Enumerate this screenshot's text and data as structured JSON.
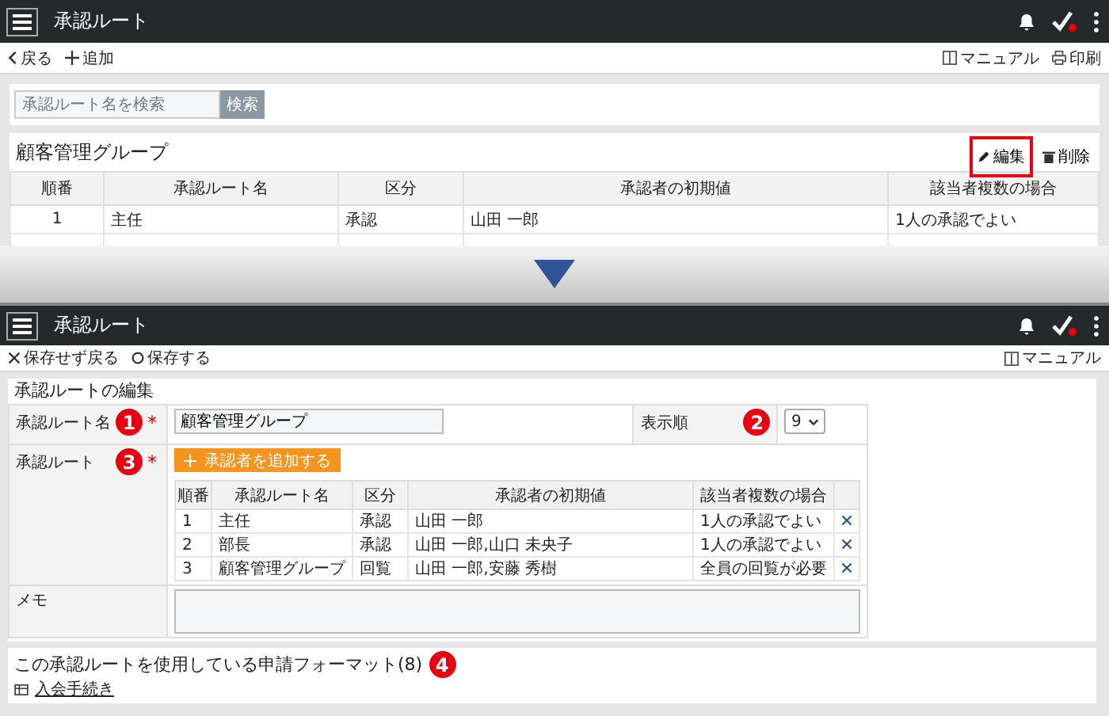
{
  "top_screen": {
    "header": {
      "title": "承認ルート"
    },
    "toolbar": {
      "back": "戻る",
      "add": "追加",
      "manual": "マニュアル",
      "print": "印刷"
    },
    "search": {
      "placeholder": "承認ルート名を検索",
      "button": "検索"
    },
    "group": {
      "title": "顧客管理グループ",
      "edit": "編集",
      "edit_highlighted": true,
      "delete": "削除"
    },
    "table": {
      "columns": [
        "順番",
        "承認ルート名",
        "区分",
        "承認者の初期値",
        "該当者複数の場合"
      ],
      "rows": [
        [
          "1",
          "主任",
          "承認",
          "山田 一郎",
          "1人の承認でよい"
        ]
      ]
    }
  },
  "bottom_screen": {
    "header": {
      "title": "承認ルート"
    },
    "toolbar": {
      "cancel": "保存せず戻る",
      "save": "保存する",
      "manual": "マニュアル"
    },
    "form": {
      "title": "承認ルートの編集",
      "name_field": {
        "label": "承認ルート名",
        "marker": "1",
        "required": "*",
        "value": "顧客管理グループ"
      },
      "order_field": {
        "label": "表示順",
        "marker": "2",
        "value": "9"
      },
      "route_field": {
        "label": "承認ルート",
        "marker": "3",
        "required": "*",
        "add_button": "承認者を追加する",
        "columns": [
          "順番",
          "承認ルート名",
          "区分",
          "承認者の初期値",
          "該当者複数の場合"
        ],
        "rows": [
          [
            "1",
            "主任",
            "承認",
            "山田 一郎",
            "1人の承認でよい"
          ],
          [
            "2",
            "部長",
            "承認",
            "山田 一郎,山口 未央子",
            "1人の承認でよい"
          ],
          [
            "3",
            "顧客管理グループ",
            "回覧",
            "山田 一郎,安藤 秀樹",
            "全員の回覧が必要"
          ]
        ]
      },
      "memo_field": {
        "label": "メモ"
      }
    },
    "usage": {
      "title": "この承認ルートを使用している申請フォーマット(8)",
      "marker": "4",
      "links": [
        "入会手続き"
      ]
    }
  }
}
